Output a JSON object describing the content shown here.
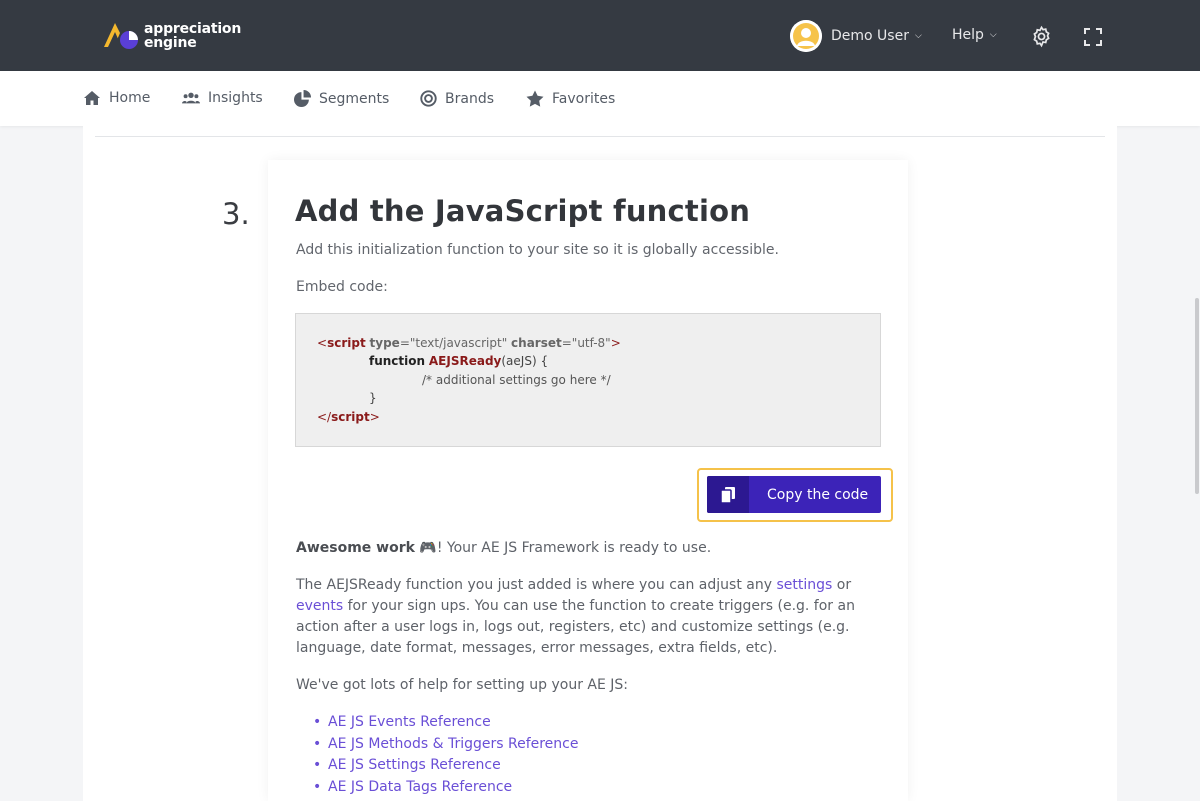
{
  "brand": {
    "line1": "appreciation",
    "line2": "engine",
    "accent": "#f5b82e",
    "purple": "#5a3fd6"
  },
  "header": {
    "user_name": "Demo User",
    "help_label": "Help"
  },
  "nav": [
    {
      "label": "Home",
      "icon": "home-icon"
    },
    {
      "label": "Insights",
      "icon": "users-icon"
    },
    {
      "label": "Segments",
      "icon": "pie-chart-icon"
    },
    {
      "label": "Brands",
      "icon": "target-icon"
    },
    {
      "label": "Favorites",
      "icon": "star-icon"
    }
  ],
  "step": {
    "number": "3.",
    "title": "Add the JavaScript function",
    "description": "Add this initialization function to your site so it is globally accessible.",
    "embed_label": "Embed code:"
  },
  "code": {
    "open_lt": "<",
    "tag_script": "script",
    "attr_type": "type",
    "eq_type": "=\"text/javascript\"",
    "attr_charset": "charset",
    "eq_charset": "=\"utf-8\"",
    "gt": ">",
    "kw_function": "function",
    "fn_name": "AEJSReady",
    "fn_args": "(aeJS) {",
    "comment": "/* additional settings go here */",
    "close_brace": "}",
    "close_lt": "</",
    "close_tag": "script",
    "close_gt": ">"
  },
  "copy_button": {
    "label": "Copy the code",
    "icon": "copy-icon",
    "highlight": "#f5c24a",
    "color": "#3c23b8"
  },
  "success": {
    "bold": "Awesome work",
    "emoji": "🎮",
    "rest": "! Your AE JS Framework is ready to use."
  },
  "para2": {
    "t1": "The AEJSReady function you just added is where you can adjust any ",
    "link1": "settings",
    "t2": " or ",
    "link2": "events",
    "t3": " for your sign ups. You can use the function to create triggers (e.g. for an action after a user logs in, logs out, registers, etc) and customize settings (e.g. language, date format, messages, error messages, extra fields, etc)."
  },
  "help_intro": "We've got lots of help for setting up your AE JS:",
  "references": [
    "AE JS Events Reference",
    "AE JS Methods & Triggers Reference",
    "AE JS Settings Reference",
    "AE JS Data Tags Reference"
  ]
}
